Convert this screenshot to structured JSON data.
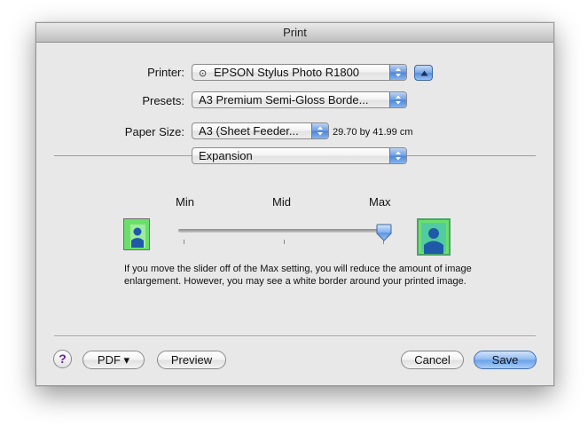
{
  "window": {
    "title": "Print"
  },
  "printer": {
    "label": "Printer:",
    "value": "EPSON Stylus Photo R1800"
  },
  "presets": {
    "label": "Presets:",
    "value": "A3 Premium Semi-Gloss Borde..."
  },
  "paper_size": {
    "label": "Paper Size:",
    "value": "A3 (Sheet Feeder...",
    "dimensions": "29.70 by 41.99 cm"
  },
  "panel": {
    "value": "Expansion"
  },
  "slider": {
    "labels": [
      "Min",
      "Mid",
      "Max"
    ],
    "value_label": "Max",
    "position_fraction": 1.0
  },
  "info_text": "If you move the slider off of the Max setting, you will reduce the amount of image enlargement. However, you may see a white border around your printed image.",
  "buttons": {
    "help": "?",
    "pdf": "PDF ▾",
    "preview": "Preview",
    "cancel": "Cancel",
    "save": "Save"
  },
  "colors": {
    "accent_blue": "#6aa2ea",
    "thumb_green": "#6ae06a",
    "person_blue": "#1f5aa8",
    "help_purple": "#6a1fa8"
  }
}
